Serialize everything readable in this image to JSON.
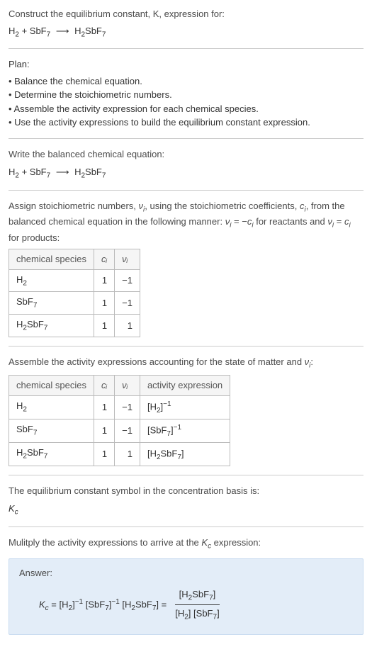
{
  "intro": {
    "line1": "Construct the equilibrium constant, K, expression for:",
    "equation_lhs1": "H",
    "equation_lhs1_sub": "2",
    "equation_plus": " + ",
    "equation_lhs2": "SbF",
    "equation_lhs2_sub": "7",
    "equation_arrow": "⟶",
    "equation_rhs": "H",
    "equation_rhs_sub1": "2",
    "equation_rhs_mid": "SbF",
    "equation_rhs_sub2": "7"
  },
  "plan": {
    "title": "Plan:",
    "items": [
      "Balance the chemical equation.",
      "Determine the stoichiometric numbers.",
      "Assemble the activity expression for each chemical species.",
      "Use the activity expressions to build the equilibrium constant expression."
    ]
  },
  "balanced": {
    "title": "Write the balanced chemical equation:"
  },
  "assign": {
    "text_a": "Assign stoichiometric numbers, ",
    "nu_i": "ν",
    "nu_sub": "i",
    "text_b": ", using the stoichiometric coefficients, ",
    "c_i": "c",
    "c_sub": "i",
    "text_c": ", from the balanced chemical equation in the following manner: ",
    "rel1": "ν",
    "rel1_sub": "i",
    "rel_eq": " = −",
    "rel_c": "c",
    "rel_c_sub": "i",
    "text_d": " for reactants and ",
    "rel2": "ν",
    "rel2_sub": "i",
    "rel2_eq": " = ",
    "rel2_c": "c",
    "rel2_c_sub": "i",
    "text_e": " for products:"
  },
  "table1": {
    "headers": {
      "h1": "chemical species",
      "h2": "cᵢ",
      "h3": "νᵢ"
    },
    "rows": [
      {
        "species_a": "H",
        "species_sub": "2",
        "species_b": "",
        "species_sub2": "",
        "ci": "1",
        "vi": "−1"
      },
      {
        "species_a": "SbF",
        "species_sub": "7",
        "species_b": "",
        "species_sub2": "",
        "ci": "1",
        "vi": "−1"
      },
      {
        "species_a": "H",
        "species_sub": "2",
        "species_b": "SbF",
        "species_sub2": "7",
        "ci": "1",
        "vi": "1"
      }
    ]
  },
  "assemble": {
    "text_a": "Assemble the activity expressions accounting for the state of matter and ",
    "nu": "ν",
    "nu_sub": "i",
    "text_b": ":"
  },
  "table2": {
    "headers": {
      "h1": "chemical species",
      "h2": "cᵢ",
      "h3": "νᵢ",
      "h4": "activity expression"
    },
    "rows": [
      {
        "species_a": "H",
        "species_sub": "2",
        "species_b": "",
        "species_sub2": "",
        "ci": "1",
        "vi": "−1",
        "act_open": "[H",
        "act_sub": "2",
        "act_mid": "",
        "act_sub2": "",
        "act_close": "]",
        "act_sup": "−1"
      },
      {
        "species_a": "SbF",
        "species_sub": "7",
        "species_b": "",
        "species_sub2": "",
        "ci": "1",
        "vi": "−1",
        "act_open": "[SbF",
        "act_sub": "7",
        "act_mid": "",
        "act_sub2": "",
        "act_close": "]",
        "act_sup": "−1"
      },
      {
        "species_a": "H",
        "species_sub": "2",
        "species_b": "SbF",
        "species_sub2": "7",
        "ci": "1",
        "vi": "1",
        "act_open": "[H",
        "act_sub": "2",
        "act_mid": "SbF",
        "act_sub2": "7",
        "act_close": "]",
        "act_sup": ""
      }
    ]
  },
  "basis": {
    "text": "The equilibrium constant symbol in the concentration basis is:",
    "kc": "K",
    "kc_sub": "c"
  },
  "multiply": {
    "text_a": "Mulitply the activity expressions to arrive at the ",
    "kc": "K",
    "kc_sub": "c",
    "text_b": " expression:"
  },
  "answer": {
    "label": "Answer:",
    "kc": "K",
    "kc_sub": "c",
    "eq": " = ",
    "t1": "[H",
    "t1_sub": "2",
    "t1_close": "]",
    "t1_sup": "−1",
    "sp1": " ",
    "t2": "[SbF",
    "t2_sub": "7",
    "t2_close": "]",
    "t2_sup": "−1",
    "sp2": " ",
    "t3": "[H",
    "t3_sub": "2",
    "t3_mid": "SbF",
    "t3_sub2": "7",
    "t3_close": "]",
    "eq2": " = ",
    "num": "[H",
    "num_sub": "2",
    "num_mid": "SbF",
    "num_sub2": "7",
    "num_close": "]",
    "den1": "[H",
    "den1_sub": "2",
    "den1_close": "]",
    "den_sp": " ",
    "den2": "[SbF",
    "den2_sub": "7",
    "den2_close": "]"
  }
}
